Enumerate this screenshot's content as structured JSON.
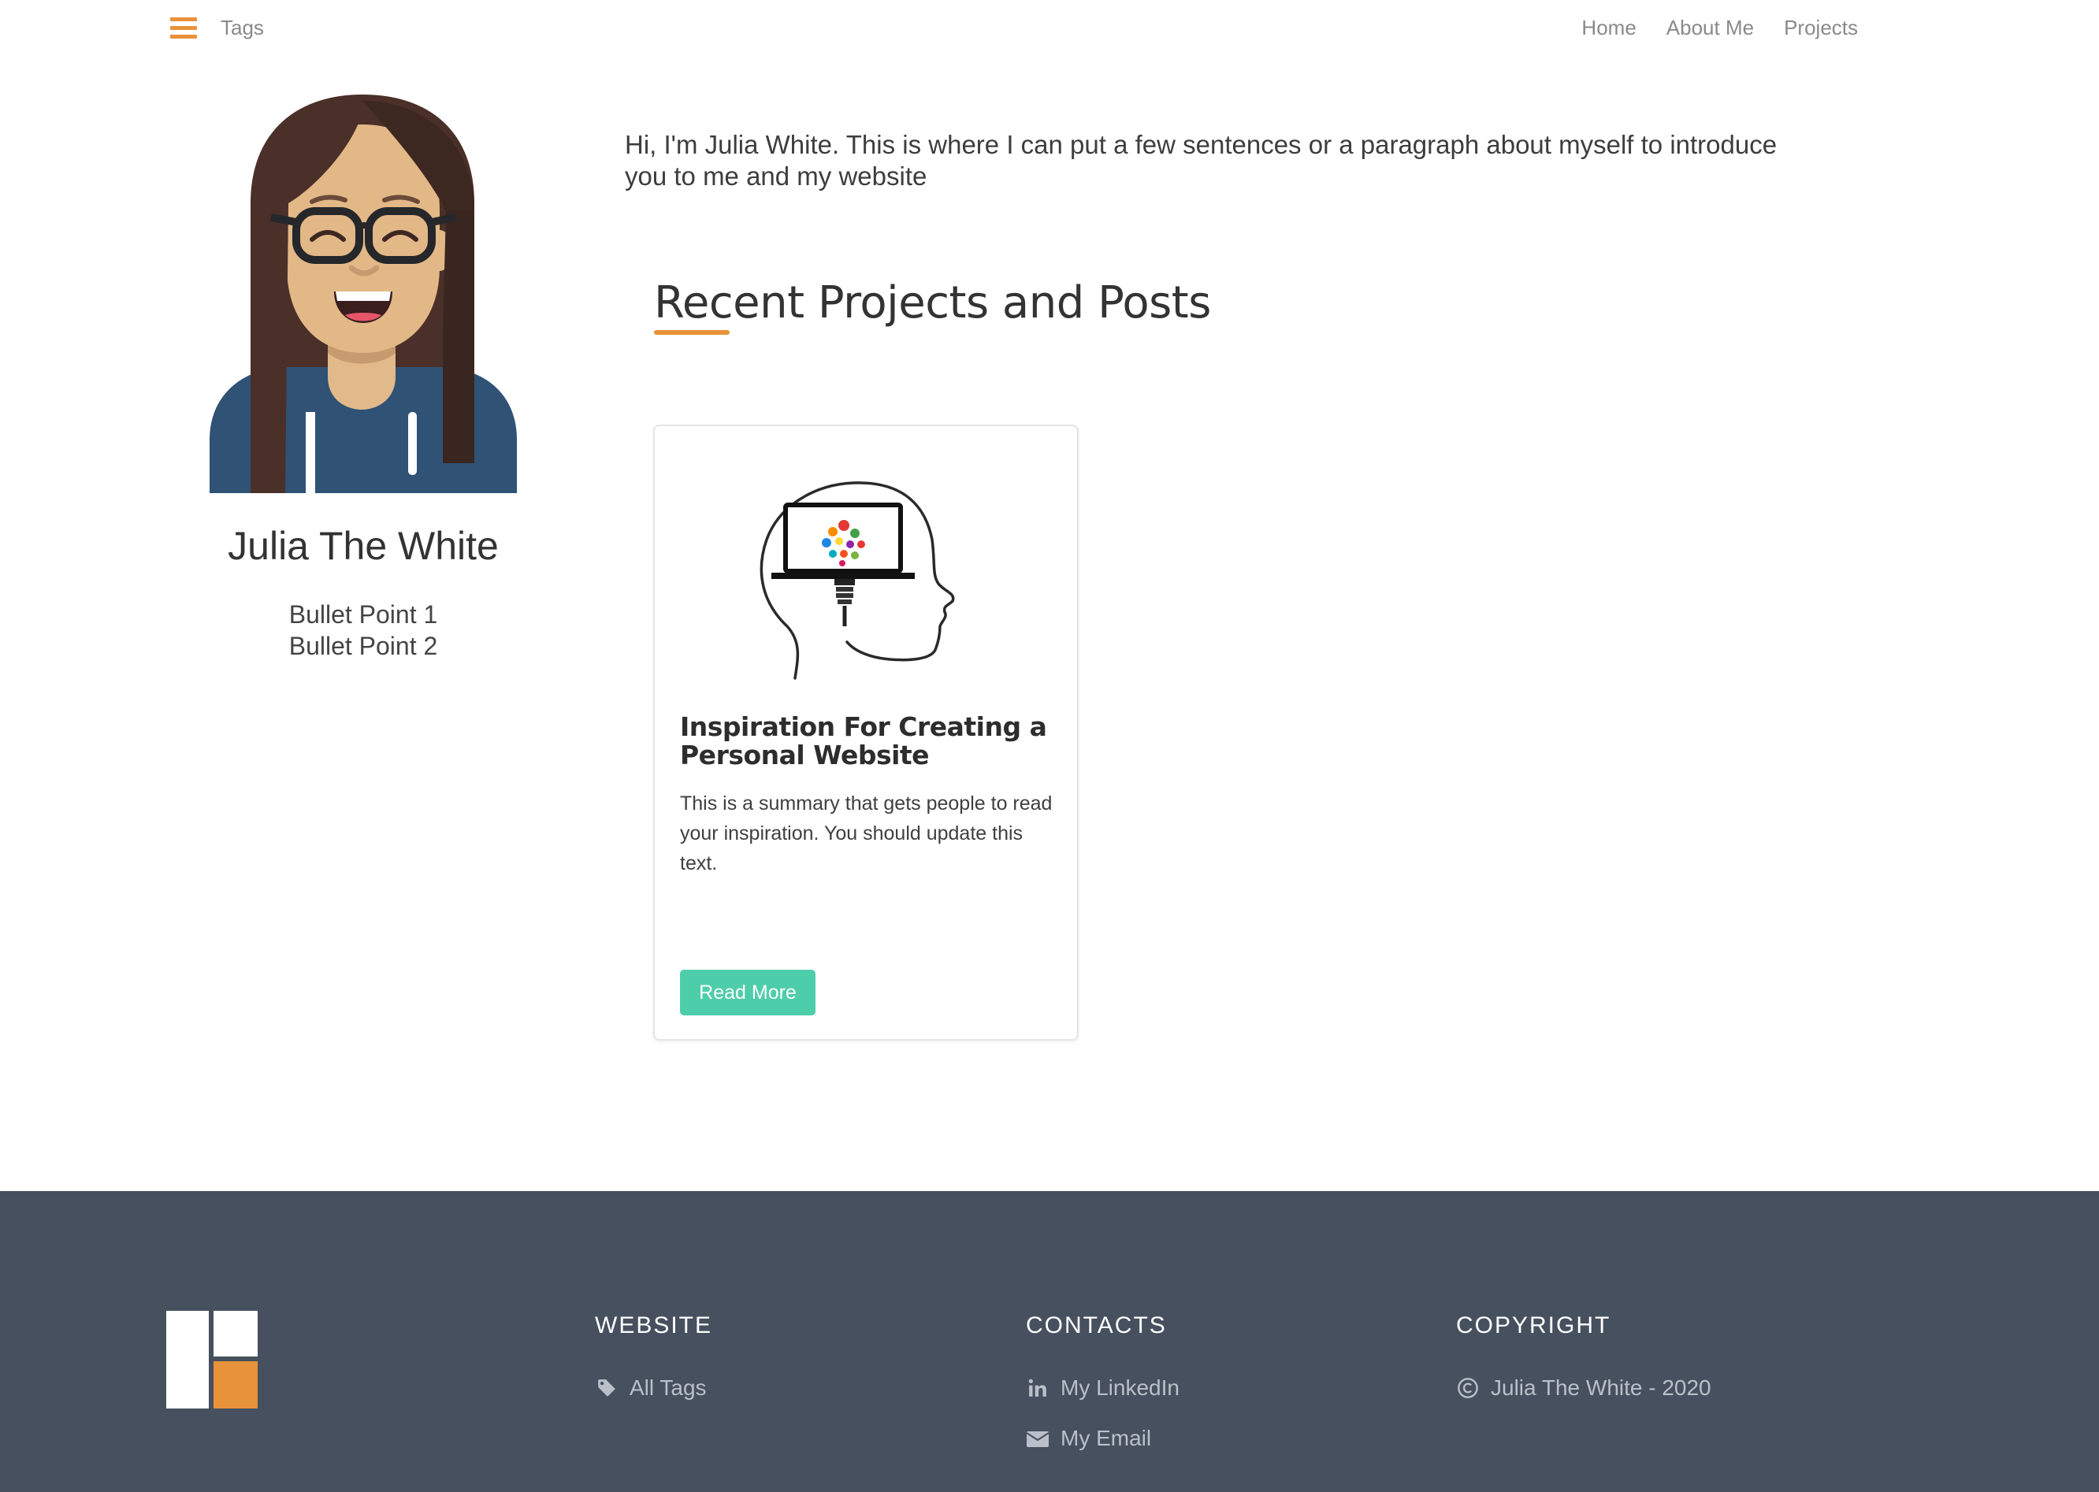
{
  "nav": {
    "tags_label": "Tags",
    "links": [
      "Home",
      "About Me",
      "Projects"
    ]
  },
  "profile": {
    "name": "Julia The White",
    "bullets": [
      "Bullet Point 1",
      "Bullet Point 2"
    ]
  },
  "intro": "Hi, I'm Julia White. This is where I can put a few sentences or a paragraph about myself to introduce you to me and my website",
  "section": {
    "title": "Recent Projects and Posts"
  },
  "card": {
    "title": "Inspiration For Creating a Personal Website",
    "summary": "This is a summary that gets people to read your inspiration. You should update this text.",
    "button_label": "Read More"
  },
  "footer": {
    "website": {
      "heading": "WEBSITE",
      "all_tags": "All Tags"
    },
    "contacts": {
      "heading": "CONTACTS",
      "linkedin": "My LinkedIn",
      "email": "My Email"
    },
    "copyright": {
      "heading": "COPYRIGHT",
      "text": "Julia The White - 2020"
    }
  },
  "colors": {
    "accent": "#e8923a",
    "button": "#4ecdaa",
    "footer_bg": "#46505e"
  }
}
